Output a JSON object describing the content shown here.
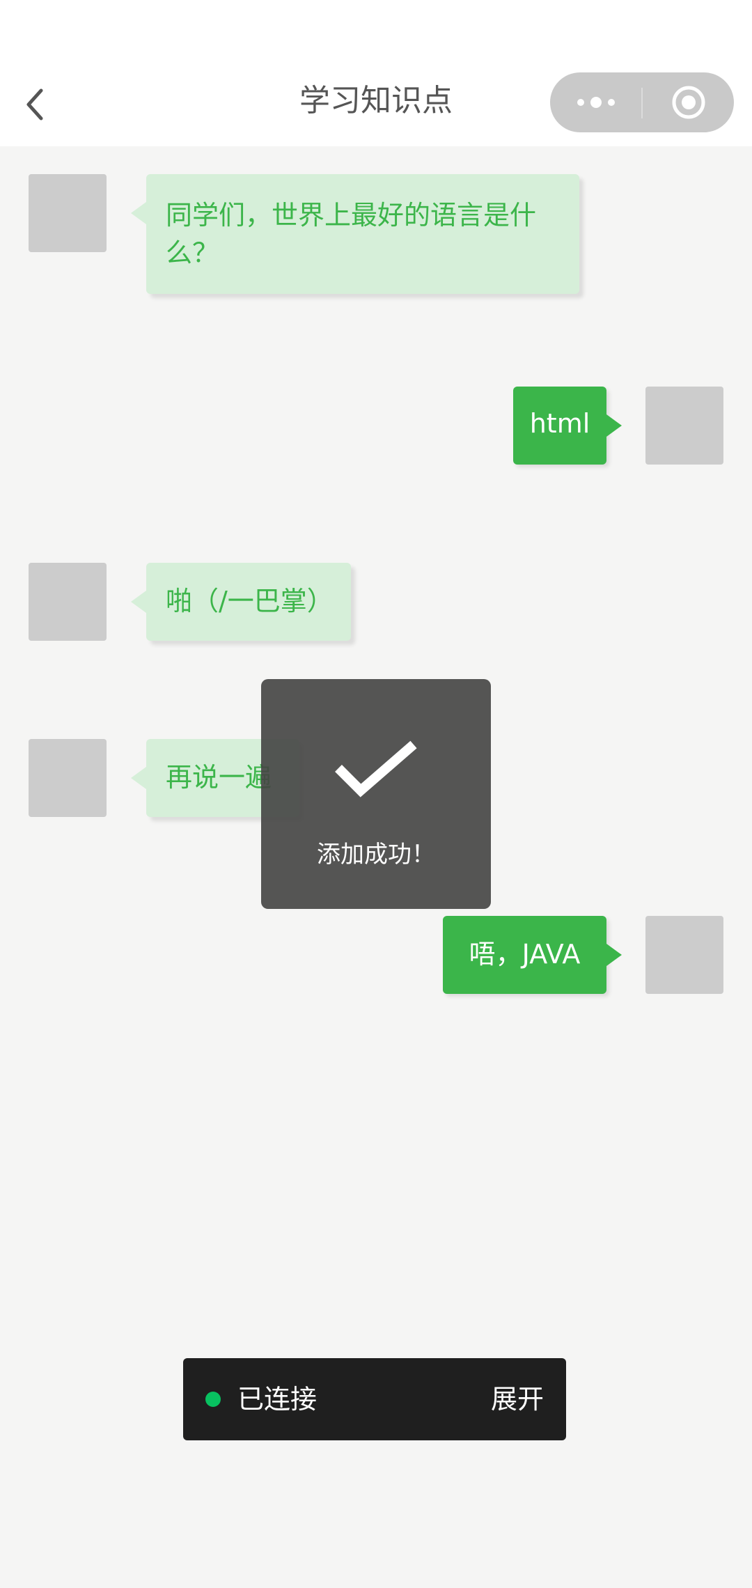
{
  "nav": {
    "title": "学习知识点",
    "back_icon": "chevron-left-icon",
    "more_icon": "more-dots-icon",
    "close_icon": "target-close-icon"
  },
  "messages": [
    {
      "side": "left",
      "text": "同学们，世界上最好的语言是什么？"
    },
    {
      "side": "right",
      "text": "html"
    },
    {
      "side": "left",
      "text": "啪（/一巴掌）"
    },
    {
      "side": "left",
      "text": "再说一遍"
    },
    {
      "side": "right",
      "text": "唔，JAVA"
    }
  ],
  "toast": {
    "icon": "checkmark-icon",
    "text": "添加成功！"
  },
  "connection": {
    "status_text": "已连接",
    "expand_label": "展开",
    "status_color": "#08c160"
  },
  "colors": {
    "accent_green": "#3bb54a",
    "left_bubble_bg": "#d6efd9",
    "avatar_placeholder": "#cccccc"
  }
}
